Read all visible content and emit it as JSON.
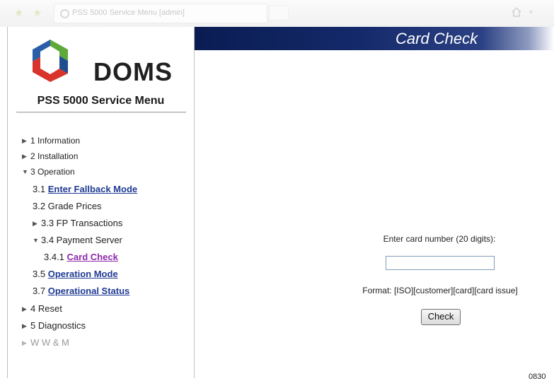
{
  "browser": {
    "tab_title": "PSS 5000 Service Menu [admin]"
  },
  "sidebar": {
    "logo_text": "DOMS",
    "menu_title": "PSS 5000 Service Menu",
    "items": [
      {
        "label": "1 Information",
        "expanded": false
      },
      {
        "label": "2 Installation",
        "expanded": false
      },
      {
        "label": "3 Operation",
        "expanded": true
      },
      {
        "prefix": "3.1",
        "link": "Enter Fallback Mode"
      },
      {
        "label": "3.2 Grade Prices"
      },
      {
        "label": "3.3 FP Transactions",
        "expanded": false
      },
      {
        "label": "3.4 Payment Server",
        "expanded": true
      },
      {
        "prefix": "3.4.1",
        "link": "Card Check",
        "active": true
      },
      {
        "prefix": "3.5",
        "link": "Operation Mode"
      },
      {
        "prefix": "3.7",
        "link": "Operational Status"
      },
      {
        "label": "4 Reset",
        "expanded": false
      },
      {
        "label": "5 Diagnostics",
        "expanded": false
      },
      {
        "label": "W W & M",
        "expanded": false,
        "disabled": true
      }
    ]
  },
  "main": {
    "header_title": "Card Check",
    "card_label": "Enter card number (20 digits):",
    "card_value": "",
    "format_text": "Format: [ISO][customer][card][card issue]",
    "check_button": "Check",
    "corner_text": "0830"
  },
  "colors": {
    "link": "#1f3a93",
    "active_link": "#8e2aa8",
    "banner_dark": "#0a1c52",
    "logo_blue": "#2a5fa8",
    "logo_green": "#5fa83a",
    "logo_red": "#d9342b"
  },
  "icons": {
    "favorites": "star-icon",
    "tab": "loading-spinner-icon",
    "home": "home-icon",
    "tree_collapsed": "triangle-right-icon",
    "tree_expanded": "triangle-down-icon"
  }
}
